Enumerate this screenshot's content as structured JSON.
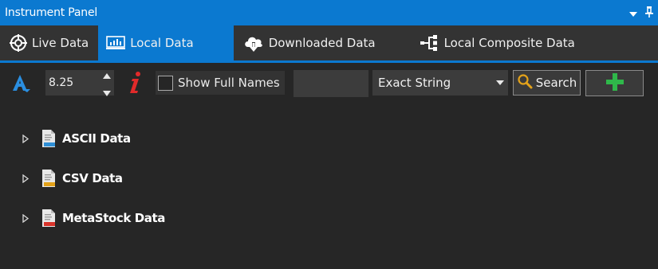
{
  "window": {
    "title": "Instrument Panel"
  },
  "tabs": [
    {
      "label": "Live Data",
      "icon": "live-data-icon",
      "active": false
    },
    {
      "label": "Local Data",
      "icon": "local-data-icon",
      "active": true
    },
    {
      "label": "Downloaded Data",
      "icon": "cloud-download-icon",
      "active": false
    },
    {
      "label": "Local Composite Data",
      "icon": "composite-icon",
      "active": false
    }
  ],
  "toolbar": {
    "font_size": "8.25",
    "show_full_names_label": "Show Full Names",
    "show_full_names_checked": false,
    "search_value": "",
    "match_mode": "Exact String",
    "search_label": "Search"
  },
  "tree": [
    {
      "label": "ASCII Data",
      "badge_color": "#2f8fd6"
    },
    {
      "label": "CSV Data",
      "badge_color": "#e3a21a"
    },
    {
      "label": "MetaStock Data",
      "badge_color": "#d9342b"
    }
  ],
  "colors": {
    "accent": "#0b79d0",
    "add_green": "#2fb84a",
    "info_red": "#e02a2a"
  }
}
